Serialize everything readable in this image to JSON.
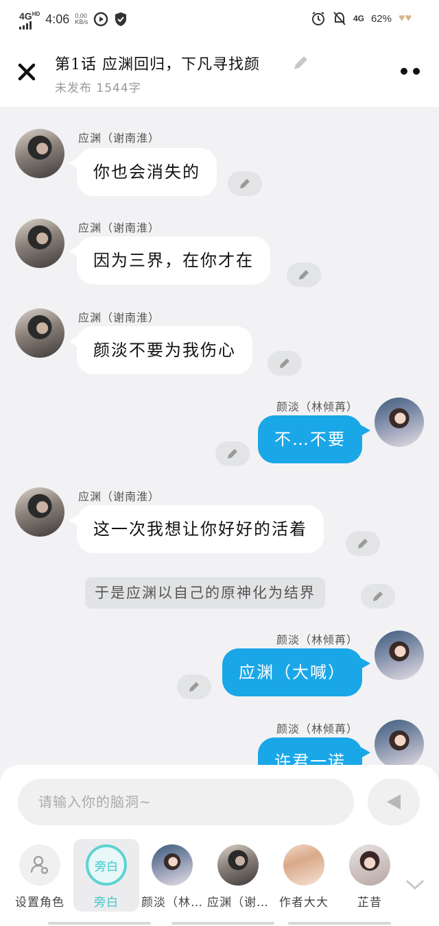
{
  "status_bar": {
    "network": "4G",
    "hd": "HD",
    "time": "4:06",
    "speed_value": "0.00",
    "speed_unit": "KB/s",
    "network_right": "4G",
    "battery": "62%"
  },
  "header": {
    "title": "第1话  应渊回归，下凡寻找颜",
    "subtitle": "未发布 1544字"
  },
  "messages": [
    {
      "side": "left",
      "speaker": "应渊（谢南淮）",
      "text": "你也会消失的"
    },
    {
      "side": "left",
      "speaker": "应渊（谢南淮）",
      "text": "因为三界，在你才在"
    },
    {
      "side": "left",
      "speaker": "应渊（谢南淮）",
      "text": "颜淡不要为我伤心"
    },
    {
      "side": "right",
      "speaker": "颜淡（林倾苒）",
      "text": "不…不要"
    },
    {
      "side": "left",
      "speaker": "应渊（谢南淮）",
      "text": "这一次我想让你好好的活着"
    },
    {
      "side": "narration",
      "text": "于是应渊以自己的原神化为结界"
    },
    {
      "side": "right",
      "speaker": "颜淡（林倾苒）",
      "text": "应渊（大喊）"
    },
    {
      "side": "right",
      "speaker": "颜淡（林倾苒）",
      "text": "许君一诺"
    }
  ],
  "composer": {
    "placeholder": "请输入你的脑洞~"
  },
  "roles": [
    {
      "label": "设置角色"
    },
    {
      "label": "旁白",
      "circle_text": "旁白",
      "active": true
    },
    {
      "label": "颜淡（林…"
    },
    {
      "label": "应渊（谢…"
    },
    {
      "label": "作者大大"
    },
    {
      "label": "芷昔"
    }
  ],
  "colors": {
    "accent_blue": "#1aa7e8",
    "narration_teal": "#3cc7c9",
    "background": "#f2f2f4"
  }
}
